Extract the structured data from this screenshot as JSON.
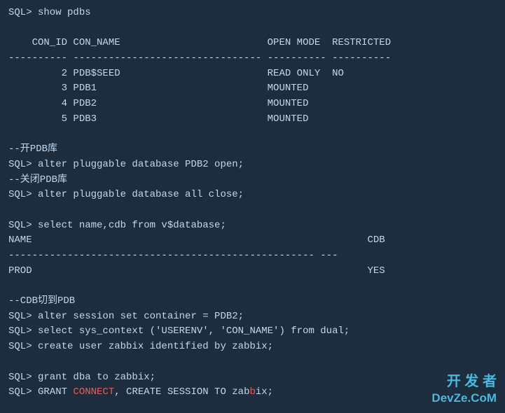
{
  "terminal": {
    "lines": [
      {
        "id": "line1",
        "text": "SQL> show pdbs",
        "type": "prompt"
      },
      {
        "id": "line2",
        "text": "",
        "type": "blank"
      },
      {
        "id": "line3",
        "text": "    CON_ID CON_NAME                         OPEN MODE  RESTRICTED",
        "type": "col-header"
      },
      {
        "id": "line4",
        "text": "---------- -------------------------------- ---------- ----------",
        "type": "separator"
      },
      {
        "id": "line5",
        "text": "         2 PDB$SEED                         READ ONLY  NO",
        "type": "data"
      },
      {
        "id": "line6",
        "text": "         3 PDB1                             MOUNTED",
        "type": "data"
      },
      {
        "id": "line7",
        "text": "         4 PDB2                             MOUNTED",
        "type": "data"
      },
      {
        "id": "line8",
        "text": "         5 PDB3                             MOUNTED",
        "type": "data"
      },
      {
        "id": "line9",
        "text": "",
        "type": "blank"
      },
      {
        "id": "line10",
        "text": "--开PDB库",
        "type": "comment"
      },
      {
        "id": "line11",
        "text": "SQL> alter pluggable database PDB2 open;",
        "type": "prompt"
      },
      {
        "id": "line12",
        "text": "--关闭PDB库",
        "type": "comment"
      },
      {
        "id": "line13",
        "text": "SQL> alter pluggable database all close;",
        "type": "prompt"
      },
      {
        "id": "line14",
        "text": "",
        "type": "blank"
      },
      {
        "id": "line15",
        "text": "SQL> select name,cdb from v$database;",
        "type": "prompt"
      },
      {
        "id": "line16",
        "text": "NAME                                                         CDB",
        "type": "col-header"
      },
      {
        "id": "line17",
        "text": "---------------------------------------------------- ---",
        "type": "separator"
      },
      {
        "id": "line18",
        "text": "PROD                                                         YES",
        "type": "data"
      },
      {
        "id": "line19",
        "text": "",
        "type": "blank"
      },
      {
        "id": "line20",
        "text": "--CDB切到PDB",
        "type": "comment"
      },
      {
        "id": "line21",
        "text": "SQL> alter session set container = PDB2;",
        "type": "prompt"
      },
      {
        "id": "line22",
        "text": "SQL> select sys_context ('USERENV', 'CON_NAME') from dual;",
        "type": "prompt"
      },
      {
        "id": "line23",
        "text": "SQL> create user zabbix identified by zabbix;",
        "type": "prompt"
      },
      {
        "id": "line24",
        "text": "",
        "type": "blank"
      },
      {
        "id": "line25",
        "text": "SQL> grant dba to zabbix;",
        "type": "prompt"
      },
      {
        "id": "line26",
        "text": "SQL> GRANT CONNECT, CREATE SESSION TO zabbix;",
        "type": "prompt-highlight"
      }
    ],
    "watermark_line1": "开 发 者",
    "watermark_line2": "DevZe.CoM"
  }
}
